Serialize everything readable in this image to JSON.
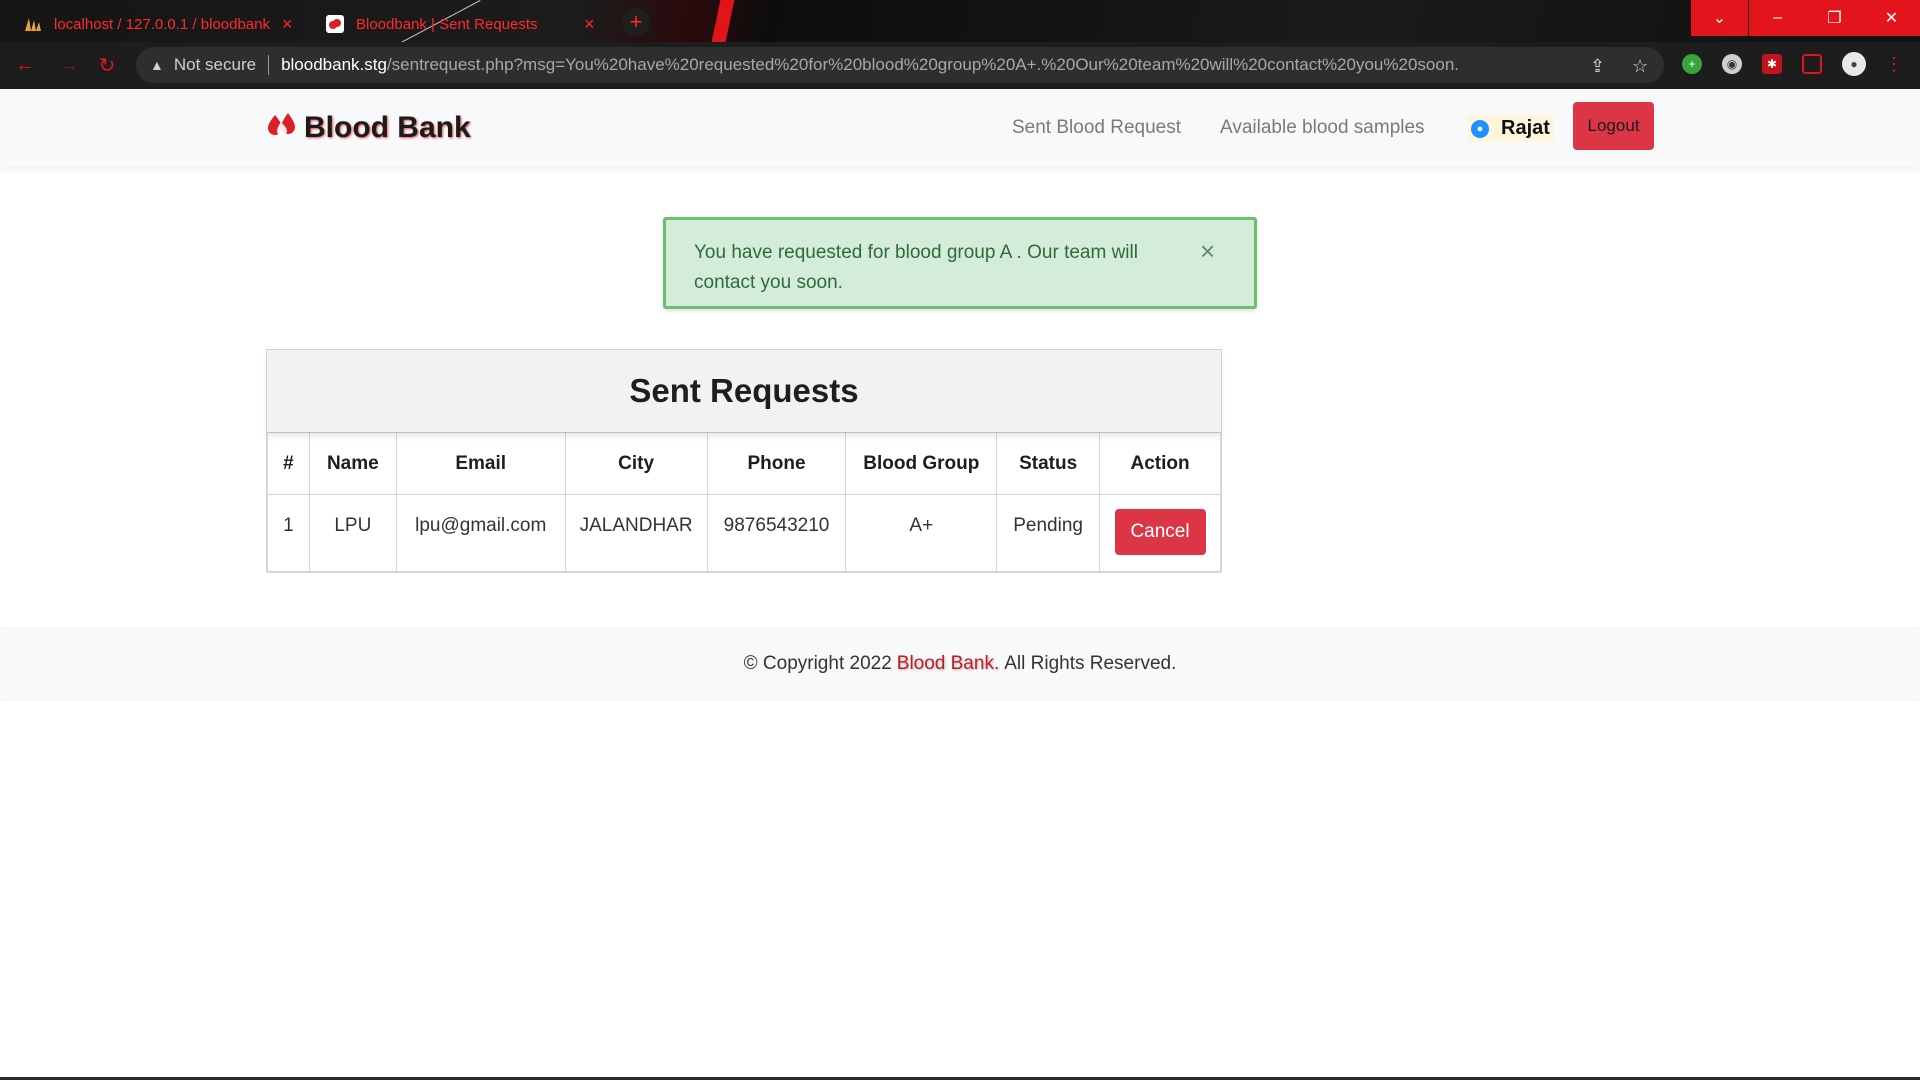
{
  "browser": {
    "tabs": [
      {
        "title": "localhost / 127.0.0.1 / bloodbank",
        "icon": "phpmyadmin-icon"
      },
      {
        "title": "Bloodbank | Sent Requests",
        "icon": "bloodbank-favicon"
      }
    ],
    "security_label": "Not secure",
    "url_host": "bloodbank.stg",
    "url_path": "/sentrequest.php?msg=You%20have%20requested%20for%20blood%20group%20A+.%20Our%20team%20will%20contact%20you%20soon.",
    "accent_color": "#e3141b"
  },
  "navbar": {
    "brand": "Blood Bank",
    "links": [
      "Sent Blood Request",
      "Available blood samples"
    ],
    "user_name": "Rajat",
    "logout_label": "Logout"
  },
  "alert": {
    "message": "You have requested for blood group A . Our team will contact you soon.",
    "close_label": "×"
  },
  "requests": {
    "title": "Sent Requests",
    "columns": [
      "#",
      "Name",
      "Email",
      "City",
      "Phone",
      "Blood Group",
      "Status",
      "Action"
    ],
    "rows": [
      {
        "num": "1",
        "name": "LPU",
        "email": "lpu@gmail.com",
        "city": "JALANDHAR",
        "phone": "9876543210",
        "blood_group": "A+",
        "status": "Pending",
        "action": "Cancel"
      }
    ]
  },
  "footer": {
    "prefix": "© Copyright 2022",
    "brand": "Blood Bank.",
    "suffix": "All Rights Reserved."
  }
}
